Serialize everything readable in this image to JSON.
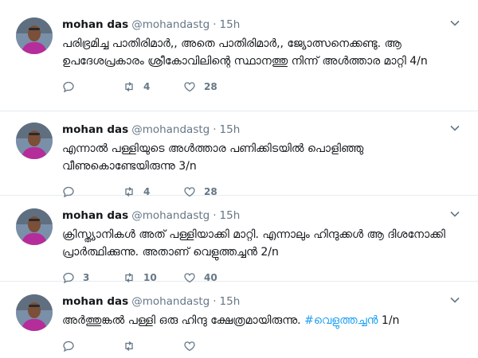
{
  "tweets": [
    {
      "name": "mohan das",
      "handle": "@mohandastg",
      "dot": "·",
      "time": "15h",
      "text": "പരിഭ്രമിച്ച പാതിരിമാർ,, അതെ പാതിരിമാർ,, ജ്യോത്സനെക്കണ്ടു. ആ ഉപദേശപ്രകാരം ശ്രീകോവിലിന്റെ സ്ഥാനത്തു നിന്ന് അൾത്താര മാറ്റി 4/n",
      "hashtag": "",
      "reply_count": "",
      "retweet_count": "4",
      "like_count": "28"
    },
    {
      "name": "mohan das",
      "handle": "@mohandastg",
      "dot": "·",
      "time": "15h",
      "text": "എന്നാൽ പള്ളിയുടെ അൾത്താര പണിക്കിടയിൽ പൊളിഞ്ഞു വീണുകൊണ്ടേയിരുന്നു 3/n",
      "hashtag": "",
      "reply_count": "",
      "retweet_count": "4",
      "like_count": "28"
    },
    {
      "name": "mohan das",
      "handle": "@mohandastg",
      "dot": "·",
      "time": "15h",
      "text": "ക്രിസ്ത്യാനികൾ അത് പള്ളിയാക്കി മാറ്റി. എന്നാലും ഹിന്ദുക്കൾ ആ ദിശനോക്കി പ്രാർത്ഥിക്കുന്നു. അതാണ് വെളുത്തച്ചൻ 2/n",
      "hashtag": "",
      "reply_count": "3",
      "retweet_count": "10",
      "like_count": "40"
    },
    {
      "name": "mohan das",
      "handle": "@mohandastg",
      "dot": "·",
      "time": "15h",
      "text": "അർത്തുങ്കൽ പള്ളി ഒരു ഹിന്ദു ക്ഷേത്രമായിരുന്നു. ",
      "hashtag": "#വെളുത്തച്ചൻ",
      "text_tail": " 1/n",
      "reply_count": "",
      "retweet_count": "",
      "like_count": ""
    }
  ],
  "colors": {
    "accent": "#1da1f2",
    "muted": "#657786",
    "text": "#14171a",
    "divider": "#e6ecf0"
  },
  "icons": {
    "reply": "reply-icon",
    "retweet": "retweet-icon",
    "like": "heart-icon",
    "caret": "chevron-down-icon"
  }
}
